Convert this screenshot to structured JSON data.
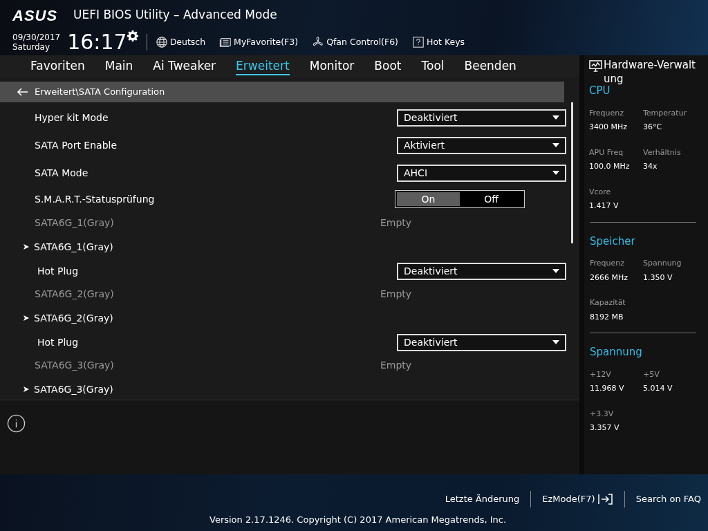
{
  "header": {
    "logo": "ASUS",
    "title": "UEFI BIOS Utility – Advanced Mode",
    "date": "09/30/2017",
    "day": "Saturday",
    "time": "16:17",
    "tools": [
      {
        "label": "Deutsch"
      },
      {
        "label": "MyFavorite(F3)"
      },
      {
        "label": "Qfan Control(F6)"
      },
      {
        "label": "Hot Keys"
      }
    ]
  },
  "tabs": [
    {
      "label": "Favoriten",
      "selected": false
    },
    {
      "label": "Main",
      "selected": false
    },
    {
      "label": "Ai Tweaker",
      "selected": false
    },
    {
      "label": "Erweitert",
      "selected": true
    },
    {
      "label": "Monitor",
      "selected": false
    },
    {
      "label": "Boot",
      "selected": false
    },
    {
      "label": "Tool",
      "selected": false
    },
    {
      "label": "Beenden",
      "selected": false
    }
  ],
  "breadcrumb": "Erweitert\\SATA Configuration",
  "rows": [
    {
      "kind": "dropdown",
      "label": "Hyper kit Mode",
      "value": "Deaktiviert"
    },
    {
      "kind": "dropdown",
      "label": "SATA Port Enable",
      "value": "Aktiviert"
    },
    {
      "kind": "dropdown",
      "label": "SATA Mode",
      "value": "AHCI"
    },
    {
      "kind": "toggle",
      "label": "S.M.A.R.T.-Statusprüfung",
      "options": [
        "On",
        "Off"
      ],
      "on": true
    },
    {
      "kind": "info",
      "label": "SATA6G_1(Gray)",
      "value": "Empty"
    },
    {
      "kind": "submenu",
      "label": "SATA6G_1(Gray)",
      "children": [
        {
          "kind": "dropdown",
          "label": "Hot Plug",
          "value": "Deaktiviert"
        }
      ]
    },
    {
      "kind": "info",
      "label": "SATA6G_2(Gray)",
      "value": "Empty"
    },
    {
      "kind": "submenu",
      "label": "SATA6G_2(Gray)",
      "children": [
        {
          "kind": "dropdown",
          "label": "Hot Plug",
          "value": "Deaktiviert"
        }
      ]
    },
    {
      "kind": "info",
      "label": "SATA6G_3(Gray)",
      "value": "Empty"
    },
    {
      "kind": "submenu",
      "label": "SATA6G_3(Gray)",
      "children": []
    }
  ],
  "sidebar": {
    "title": "Hardware-Verwaltung",
    "sections": [
      {
        "title": "CPU",
        "items": [
          {
            "label": "Frequenz",
            "value": "3400 MHz"
          },
          {
            "label": "Temperatur",
            "value": "36°C"
          },
          {
            "label": "APU Freq",
            "value": "100.0 MHz"
          },
          {
            "label": "Verhältnis",
            "value": "34x"
          },
          {
            "label": "Vcore",
            "value": "1.417 V"
          }
        ]
      },
      {
        "title": "Speicher",
        "items": [
          {
            "label": "Frequenz",
            "value": "2666 MHz"
          },
          {
            "label": "Spannung",
            "value": "1.350 V"
          },
          {
            "label": "Kapazität",
            "value": "8192 MB"
          }
        ]
      },
      {
        "title": "Spannung",
        "items": [
          {
            "label": "+12V",
            "value": "11.968 V"
          },
          {
            "label": "+5V",
            "value": "5.014 V"
          },
          {
            "label": "+3.3V",
            "value": "3.357 V"
          }
        ]
      }
    ]
  },
  "footer": {
    "links": [
      {
        "label": "Letzte Änderung"
      },
      {
        "label": "EzMode(F7)"
      },
      {
        "label": "Search on FAQ"
      }
    ],
    "version": "Version 2.17.1246. Copyright (C) 2017 American Megatrends, Inc."
  }
}
